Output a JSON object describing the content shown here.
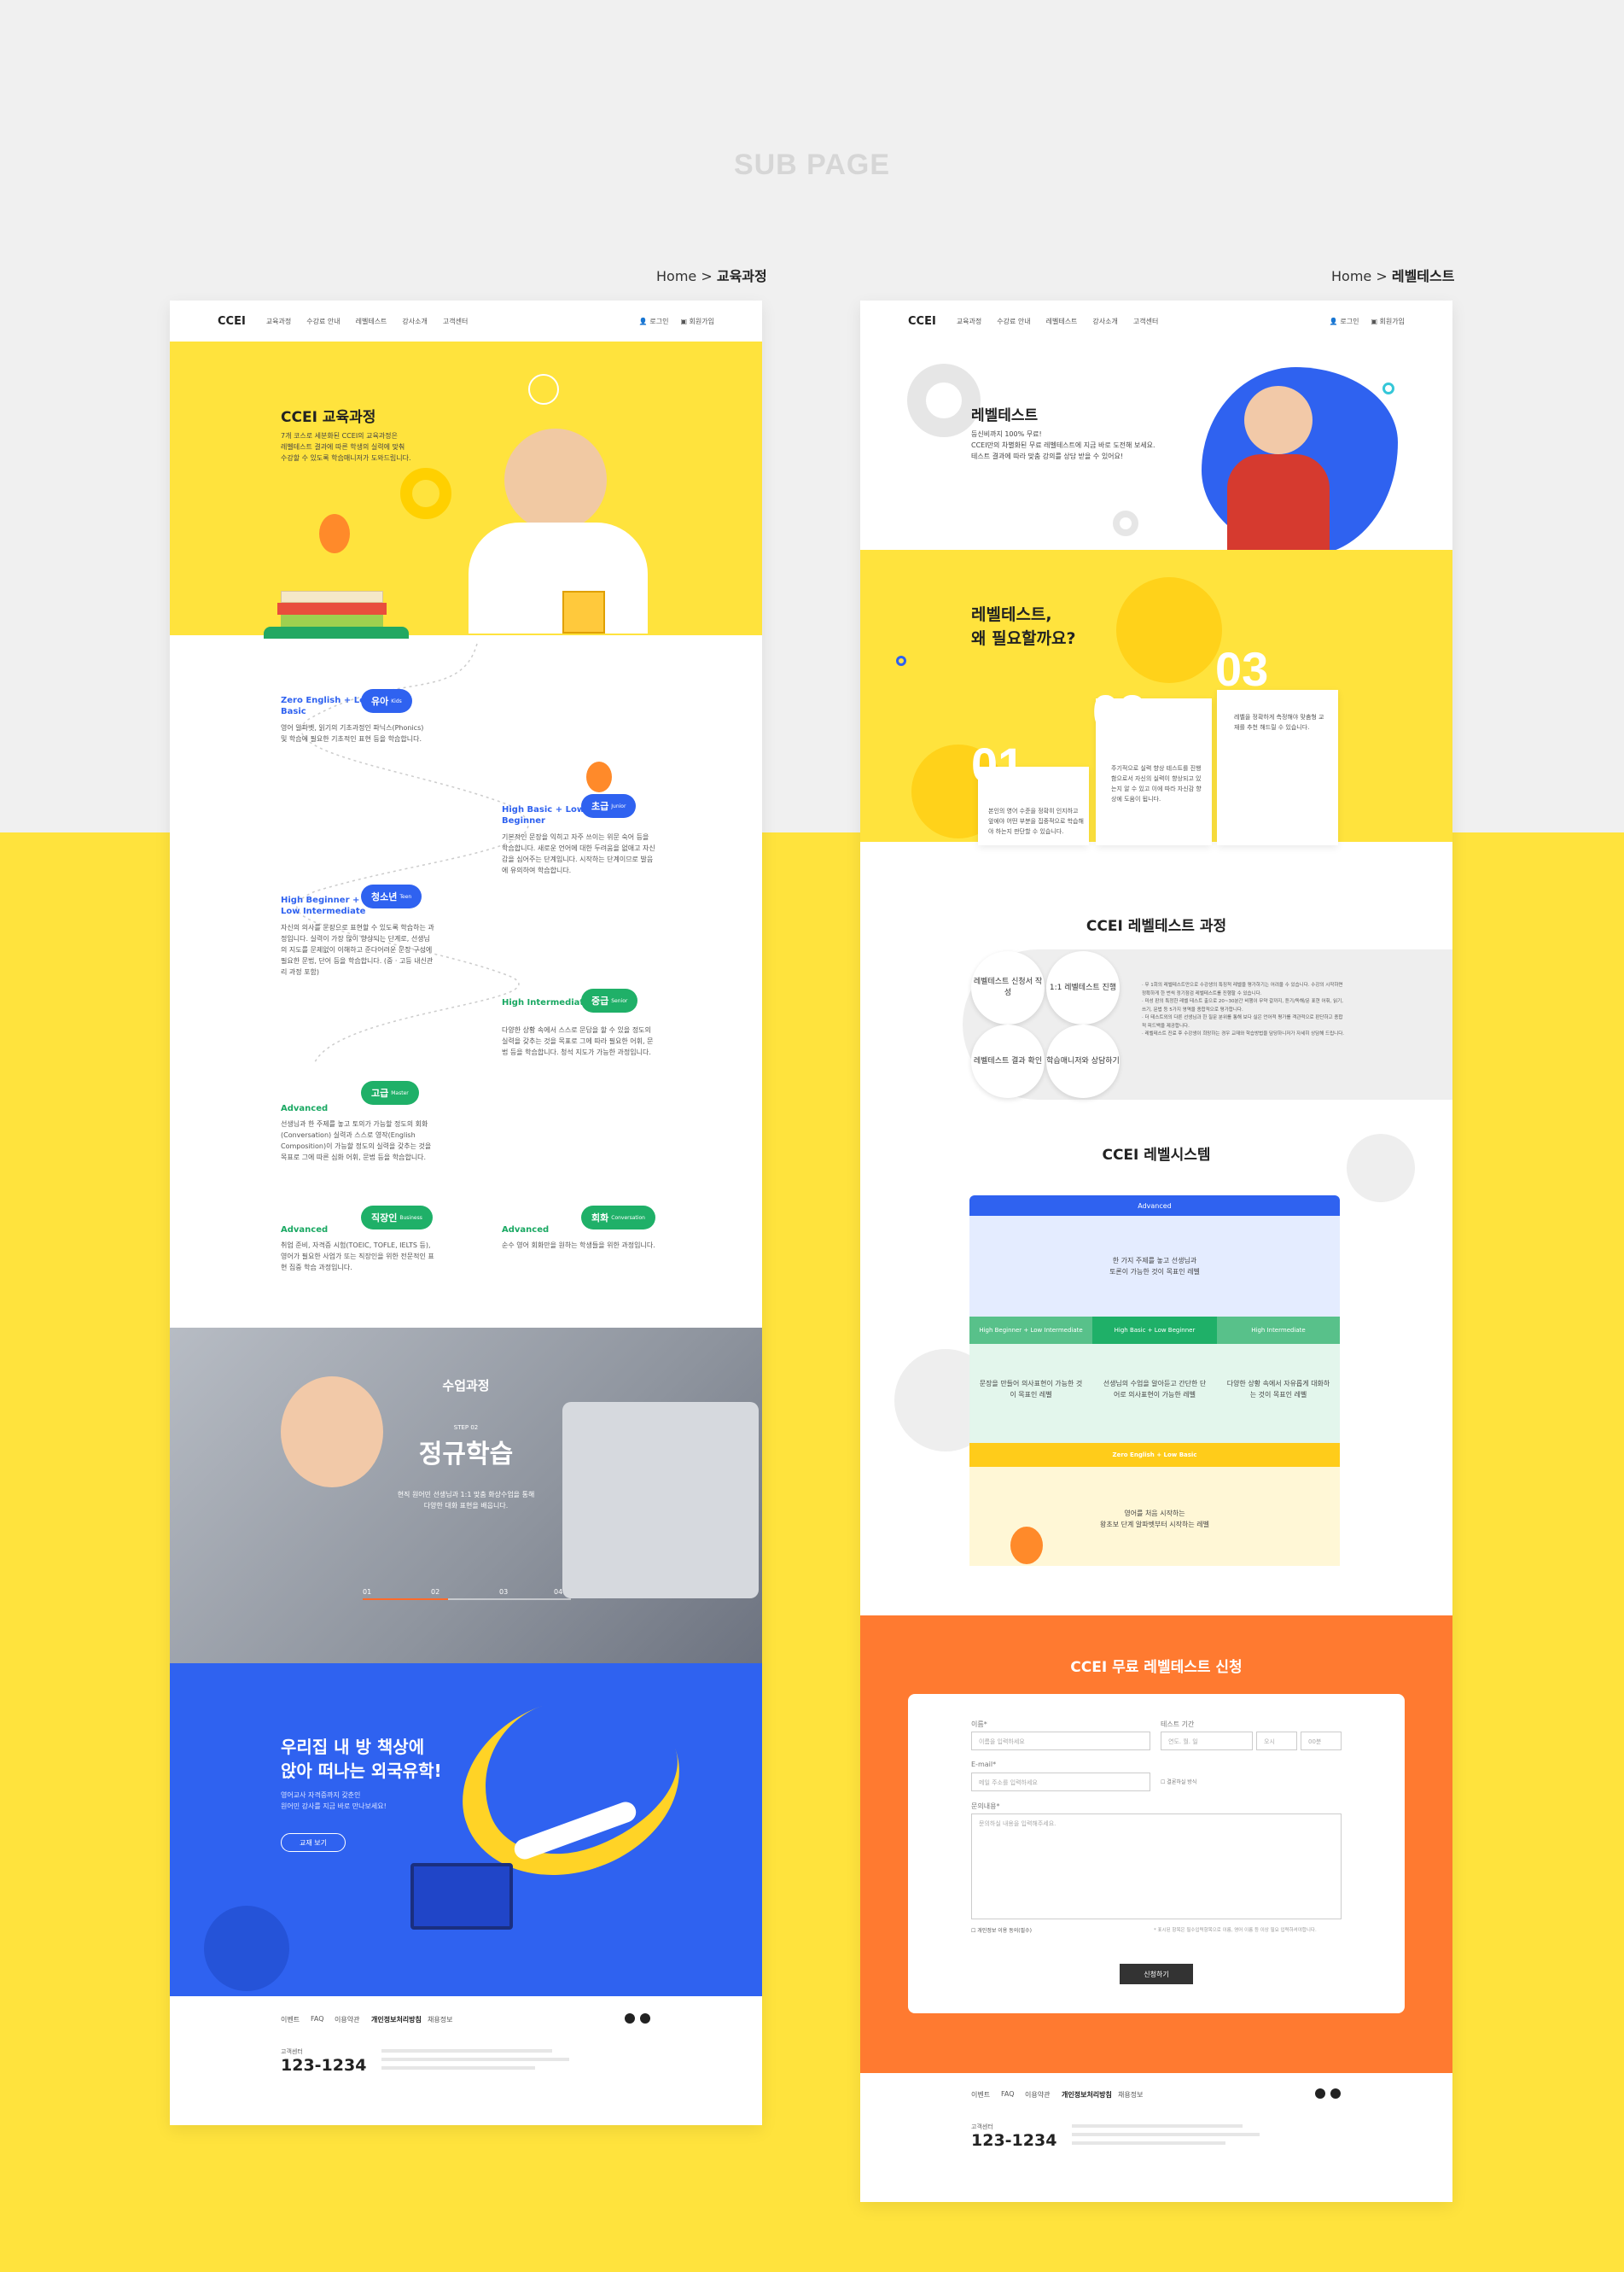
{
  "page_heading": "SUB PAGE",
  "left": {
    "crumb_home": "Home >",
    "crumb_current": "교육과정",
    "nav": {
      "logo": "CCEI",
      "items": [
        "교육과정",
        "수강료 안내",
        "레벨테스트",
        "강사소개",
        "고객센터"
      ],
      "login": "로그인",
      "join": "회원가입"
    },
    "hero": {
      "title": "CCEI 교육과정",
      "desc1": "7개 코스로 세분화된 CCEI의 교육과정은",
      "desc2": "레벨테스트 결과에 따른 학생의 실력에 맞춰",
      "desc3": "수강할 수 있도록 학습매니저가 도와드립니다."
    },
    "courses": [
      {
        "title": "Zero English + Low Basic",
        "badge": "유아",
        "badge_sub": "Kids",
        "desc": "영어 알파벳, 읽기의 기초과정인 파닉스(Phonics) 및 학습에 필요한 기초적인 표현 등을 학습합니다."
      },
      {
        "title": "High Basic + Low Beginner",
        "badge": "초급",
        "badge_sub": "Junior",
        "desc": "기본적인 문장을 익히고 자주 쓰이는 위문 숙어 등을 학습합니다. 새로운 언어에 대한 두려움을 없애고 자신감을 심어주는 단계입니다. 시작하는 단계이므로 발음에 유의하여 학습합니다."
      },
      {
        "title": "High Beginner + Low Intermediate",
        "badge": "청소년",
        "badge_sub": "Teen",
        "desc": "자신의 의사를 문장으로 표현할 수 있도록 학습하는 과정입니다. 실력이 가장 많이 향상되는 단계로, 선생님의 지도를 문제없이 이해하고 준다어려운 문장 구성에 필요한 문법, 단어 등을 학습합니다. (중 · 고등 내신관리 과정 포함)"
      },
      {
        "title": "High Intermediate",
        "badge": "중급",
        "badge_sub": "Senior",
        "desc": "다양한 상황 속에서 스스로 문답을 할 수 있을 정도의 실력을 갖추는 것을 목표로 그에 따라 필요한 어휘, 문법 등을 학습합니다. 청석 지도가 가능한 과정입니다."
      },
      {
        "title": "Advanced",
        "badge": "고급",
        "badge_sub": "Master",
        "desc": "선생님과 한 주제를 놓고 토의가 가능할 정도의 회화(Conversation) 실력과 스스로 영작(English Composition)이 가능할 정도의 실력을 갖추는 것을 목표로 그에 따른 심화 어휘, 문법 등을 학습합니다."
      },
      {
        "title": "Advanced",
        "badge": "직장인",
        "badge_sub": "Business",
        "desc": "취업 준비, 자격증 시험(TOEIC, TOFLE, IELTS 등), 영어가 필요한 사업가 또는 직장인을 위한 전문적인 표현 집중 학습 과정입니다."
      },
      {
        "title": "Advanced",
        "badge": "회화",
        "badge_sub": "Conversation",
        "desc": "순수 영어 회화만을 원하는 학생들을 위한 과정입니다."
      }
    ],
    "video": {
      "small": "수업과정",
      "step": "STEP 02",
      "big": "정규학습",
      "desc1": "현직 원어민 선생님과 1:1 맞춤 화상수업을 통해",
      "desc2": "다양한 대화 표현을 배웁니다.",
      "steps": [
        "01",
        "02",
        "03",
        "04"
      ]
    },
    "promo": {
      "line1": "우리집 내 방 책상에",
      "line2": "앉아 떠나는 외국유학!",
      "desc1": "영어교사 자격증까지 갖춘인",
      "desc2": "원어민 강사를 지금 바로 만나보세요!",
      "button": "교재 보기"
    },
    "footer": {
      "links": [
        "이벤트",
        "FAQ",
        "이용약관",
        "개인정보처리방침",
        "채용정보"
      ],
      "label": "고객센터",
      "phone": "123-1234"
    }
  },
  "right": {
    "crumb_home": "Home >",
    "crumb_current": "레벨테스트",
    "nav": {
      "logo": "CCEI",
      "items": [
        "교육과정",
        "수강료 안내",
        "레벨테스트",
        "강사소개",
        "고객센터"
      ],
      "login": "로그인",
      "join": "회원가입"
    },
    "hero": {
      "title": "레벨테스트",
      "desc1": "등신비까지 100% 무료!",
      "desc2": "CCEI만의 차별화된 무료 레벨테스트에 지금 바로 도전해 보세요.",
      "desc3": "테스트 결과에 따라 맞춤 강의를 상담 받을 수 있어요!"
    },
    "why": {
      "line1": "레벨테스트,",
      "line2": "왜 필요할까요?",
      "items": [
        {
          "num": "01",
          "text": "본인의 영어 수준을 정확히 인지하고 앞에야 어떤 부분을 집중적으로 학습해야 하는지 판단할 수 있습니다."
        },
        {
          "num": "02",
          "text": "주기적으로 실력 향상 테스트를 진행함으로서 자신의 실력이 향상되고 있는지 알 수 있고 이에 따라 자신감 향상에 도움이 됩니다."
        },
        {
          "num": "03",
          "text": "레벨을 정확하게 측정해야 맞춤형 교재를 추천 해드릴 수 있습니다."
        }
      ]
    },
    "process": {
      "title": "CCEI 레벨테스트 과정",
      "steps": [
        "레벨테스트 신청서 작성",
        "1:1 레벨테스트 진행",
        "레벨테스트 결과 확인",
        "학습매니저와 상담하기"
      ],
      "notes": [
        "· 무 1회의 레벨테스트만으로 수강생의 특징적 레벨을 평가하기는 어려울 수 있습니다. 수강의 시작하면 정확하게 한 번씩 정기점검 레벨테스트를 진행할 수 있습니다.",
        "· 미성 판의 특정한 레벨 테스트 출으로 20~30분간 비행이 무약 갈까지, 듣기/독해/문 표현 어휘, 읽기, 쓰기, 문법 등 5가지 영역을 종합적으로 평가합니다.",
        "· 더 테스트외의 다른 선생님과 한 질문 분위를 통해 보다 실은 언어적 평가를 객관적으로 판단하고 종합적 피드백을 제공합니다.",
        "· 레벨테스트 진료 후 수강생이 희망하는 경우 교재와 학습방법을 담당하니저가 자세히 상담해 드립니다."
      ]
    },
    "system": {
      "title": "CCEI 레벨시스템",
      "top": "Advanced",
      "top_desc1": "한 가지 주제를 놓고 선생님과",
      "top_desc2": "토론이 가능한 것이 목표인 레벨",
      "mid_tabs": [
        "High Beginner + Low Intermediate",
        "High Basic + Low Beginner",
        "High Intermediate"
      ],
      "mid_desc": [
        "문장을 만들어 의사표현이 가능한 것이 목표인 레벨",
        "선생님의 수업을 알아듣고 간단한 단어로 의사표현이 가능한 레벨",
        "다양한 상황 속에서 자유롭게 대화하는 것이 목표인 레벨"
      ],
      "bottom": "Zero English + Low Basic",
      "bottom_desc1": "영어를 처음 시작하는",
      "bottom_desc2": "왕초보 단계 알파벳부터 시작하는 레벨"
    },
    "form": {
      "title": "CCEI 무료 레벨테스트 신청",
      "name_label": "이름*",
      "name_ph": "이름을 입력하세요",
      "date_label": "테스트 기간",
      "date_ph": "연도. 월. 일",
      "time_h": "오시",
      "time_m": "00분",
      "email_label": "E-mail*",
      "email_ph": "메일 주소를 입력하세요",
      "consult": "결론하실 방식",
      "content_label": "문의내용*",
      "content_ph": "문의하실 내용을 입력해주세요.",
      "agree": "개인정보 이용 동의(필수)",
      "note": "* 표시된 항목은 필수입력항목으로 이름, 영어 이름 등 이상 필요 입력하셔야합니다.",
      "submit": "신청하기"
    },
    "footer": {
      "links": [
        "이벤트",
        "FAQ",
        "이용약관",
        "개인정보처리방침",
        "채용정보"
      ],
      "label": "고객센터",
      "phone": "123-1234"
    }
  },
  "colors": {
    "yellow": "#ffe33d",
    "blue": "#2f62f0",
    "green": "#1fb068",
    "orange": "#ff7a30"
  }
}
